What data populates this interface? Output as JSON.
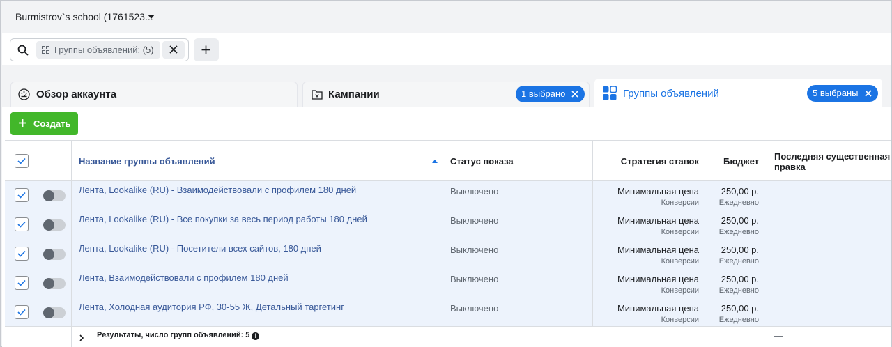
{
  "account": {
    "name": "Burmistrov`s school (1761523..."
  },
  "search": {
    "filter_label": "Группы объявлений:",
    "filter_count": "(5)"
  },
  "tabs": [
    {
      "label": "Обзор аккаунта"
    },
    {
      "label": "Кампании",
      "badge": "1 выбрано"
    },
    {
      "label": "Группы объявлений",
      "badge": "5 выбраны"
    }
  ],
  "toolbar": {
    "create_label": "Создать"
  },
  "table": {
    "headers": {
      "name": "Название группы объявлений",
      "status": "Статус показа",
      "bid": "Стратегия ставок",
      "budget": "Бюджет",
      "last_edit_1": "Последняя существенная",
      "last_edit_2": "правка"
    },
    "rows": [
      {
        "name": "Лента, Lookalike (RU) - Взаимодействовали с профилем 180 дней",
        "status": "Выключено",
        "bid": "Минимальная цена",
        "bid_sub": "Конверсии",
        "budget": "250,00 р.",
        "budget_sub": "Ежедневно"
      },
      {
        "name": "Лента, Lookalike (RU) - Все покупки за весь период работы 180 дней",
        "status": "Выключено",
        "bid": "Минимальная цена",
        "bid_sub": "Конверсии",
        "budget": "250,00 р.",
        "budget_sub": "Ежедневно"
      },
      {
        "name": "Лента, Lookalike (RU) - Посетители всех сайтов, 180 дней",
        "status": "Выключено",
        "bid": "Минимальная цена",
        "bid_sub": "Конверсии",
        "budget": "250,00 р.",
        "budget_sub": "Ежедневно"
      },
      {
        "name": "Лента, Взаимодействовали с профилем 180 дней",
        "status": "Выключено",
        "bid": "Минимальная цена",
        "bid_sub": "Конверсии",
        "budget": "250,00 р.",
        "budget_sub": "Ежедневно"
      },
      {
        "name": "Лента, Холодная аудитория РФ, 30-55 Ж, Детальный таргетинг",
        "status": "Выключено",
        "bid": "Минимальная цена",
        "bid_sub": "Конверсии",
        "budget": "250,00 р.",
        "budget_sub": "Ежедневно"
      }
    ],
    "footer": {
      "summary": "Результаты, число групп объявлений: 5",
      "info": "i",
      "last_edit": "—"
    }
  },
  "colors": {
    "accent": "#1b74e4",
    "create": "#42b72a",
    "row_selected": "#edf3fc",
    "link": "#385898"
  }
}
